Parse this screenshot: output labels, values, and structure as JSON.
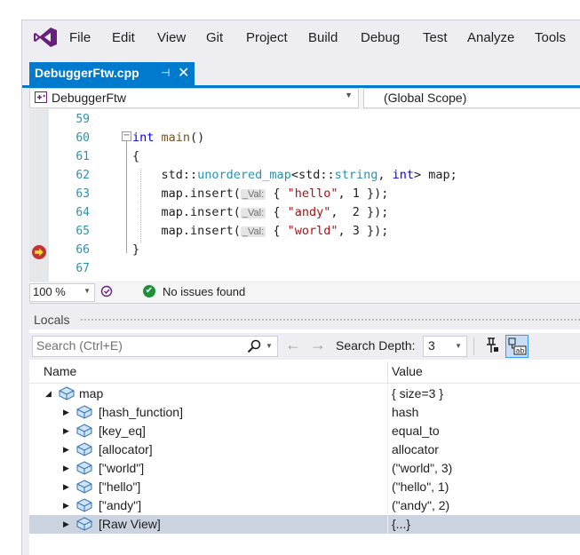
{
  "menu": {
    "items": [
      "File",
      "Edit",
      "View",
      "Git",
      "Project",
      "Build",
      "Debug",
      "Test",
      "Analyze",
      "Tools"
    ]
  },
  "tab": {
    "title": "DebuggerFtw.cpp",
    "pin_glyph": "⊣",
    "close_glyph": "✕"
  },
  "navbar": {
    "project": "DebuggerFtw",
    "scope": "(Global Scope)"
  },
  "editor": {
    "line_numbers": [
      "59",
      "60",
      "61",
      "62",
      "63",
      "64",
      "65",
      "66",
      "67"
    ],
    "current_line": "66",
    "param_hint": "_Val:"
  },
  "status": {
    "zoom": "100 %",
    "issues": "No issues found"
  },
  "locals": {
    "title": "Locals",
    "search_placeholder": "Search (Ctrl+E)",
    "search_depth_label": "Search Depth:",
    "search_depth_value": "3",
    "col_name": "Name",
    "col_value": "Value",
    "rows": [
      {
        "name": "map",
        "value": "{ size=3 }",
        "expanded": true,
        "level": 0
      },
      {
        "name": "[hash_function]",
        "value": "hash",
        "expanded": false,
        "level": 1
      },
      {
        "name": "[key_eq]",
        "value": "equal_to",
        "expanded": false,
        "level": 1
      },
      {
        "name": "[allocator]",
        "value": "allocator",
        "expanded": false,
        "level": 1
      },
      {
        "name": "[\"world\"]",
        "value": "(\"world\", 3)",
        "expanded": false,
        "level": 1
      },
      {
        "name": "[\"hello\"]",
        "value": "(\"hello\", 1)",
        "expanded": false,
        "level": 1
      },
      {
        "name": "[\"andy\"]",
        "value": "(\"andy\", 2)",
        "expanded": false,
        "level": 1
      },
      {
        "name": "[Raw View]",
        "value": "{...}",
        "expanded": false,
        "level": 1,
        "selected": true
      }
    ]
  },
  "colors": {
    "accent": "#007acc",
    "logo": "#68217a",
    "keyword": "#0000ff",
    "type": "#2b91af",
    "string": "#a31515",
    "selection": "#ccd3e0"
  }
}
